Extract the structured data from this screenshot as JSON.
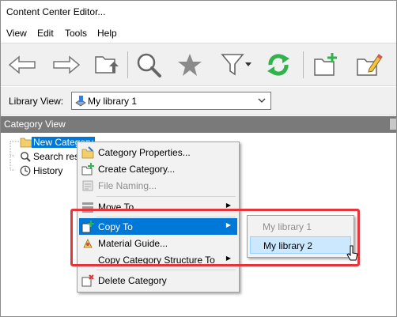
{
  "window": {
    "title": "Content Center Editor..."
  },
  "menubar": {
    "items": [
      "View",
      "Edit",
      "Tools",
      "Help"
    ]
  },
  "toolbar": {
    "buttons": [
      "arrow-left-icon",
      "arrow-right-icon",
      "folder-up-icon",
      "search-icon",
      "favorite-star-icon",
      "filter-icon",
      "refresh-icon",
      "new-category-icon",
      "edit-category-icon"
    ]
  },
  "library": {
    "label": "Library View:",
    "selected": "My library 1"
  },
  "category_view": {
    "label": "Category View"
  },
  "tree": {
    "items": [
      "New Category",
      "Search resu",
      "History"
    ]
  },
  "context_menu": {
    "items": [
      {
        "label": "Category Properties...",
        "icon": "category-properties-icon",
        "enabled": true
      },
      {
        "label": "Create Category...",
        "icon": "create-category-icon",
        "enabled": true
      },
      {
        "label": "File Naming...",
        "icon": "file-naming-icon",
        "enabled": false
      },
      {
        "label": "Move To",
        "icon": "move-to-icon",
        "enabled": false,
        "submenu": true
      },
      {
        "label": "Copy To",
        "icon": "copy-to-icon",
        "enabled": true,
        "submenu": true,
        "highlighted": true
      },
      {
        "label": "Material Guide...",
        "icon": "material-guide-icon",
        "enabled": true
      },
      {
        "label": "Copy Category Structure To",
        "enabled": true,
        "submenu": true
      },
      {
        "label": "Delete Category",
        "icon": "delete-category-icon",
        "enabled": true
      }
    ]
  },
  "submenu": {
    "items": [
      {
        "label": "My library 1",
        "enabled": false
      },
      {
        "label": "My library 2",
        "enabled": true,
        "highlighted": true
      }
    ]
  },
  "colors": {
    "highlight": "#0078d7",
    "annotation": "#e8333a",
    "refresh_green": "#2fb34a"
  }
}
